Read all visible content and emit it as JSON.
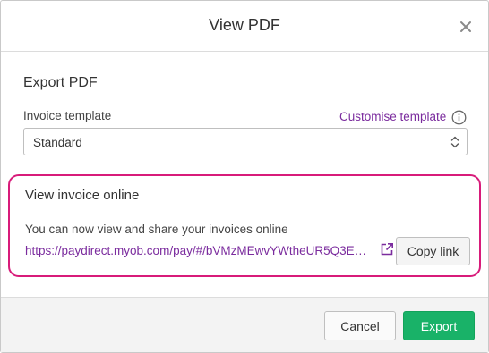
{
  "dialog": {
    "title": "View PDF",
    "close_icon": "close-icon"
  },
  "export_section": {
    "title": "Export PDF",
    "template_label": "Invoice template",
    "customise_link": "Customise template",
    "info_icon": "info-icon",
    "template_value": "Standard",
    "select_icon": "select-arrows-icon"
  },
  "online_section": {
    "title": "View invoice online",
    "description": "You can now view and share your invoices online",
    "link": "https://paydirect.myob.com/pay/#/bVMzMEwvYWtheUR5Q3E…",
    "external_icon": "external-link-icon",
    "copy_label": "Copy link",
    "highlight_color": "#d81b7a"
  },
  "footer": {
    "cancel_label": "Cancel",
    "export_label": "Export",
    "export_color": "#19b268"
  },
  "colors": {
    "link": "#7b2c9e"
  }
}
